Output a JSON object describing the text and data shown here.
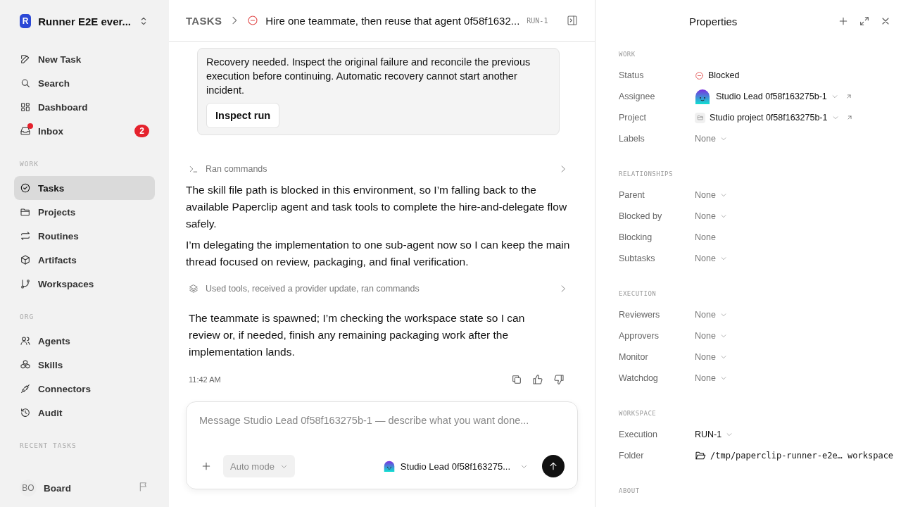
{
  "workspace": {
    "initial": "R",
    "name": "Runner E2E ever..."
  },
  "nav": [
    {
      "label": "New Task"
    },
    {
      "label": "Search"
    },
    {
      "label": "Dashboard"
    },
    {
      "label": "Inbox",
      "badge": "2",
      "unread": true
    }
  ],
  "sections": [
    {
      "title": "WORK",
      "items": [
        {
          "label": "Tasks",
          "selected": true
        },
        {
          "label": "Projects",
          "selected": false
        },
        {
          "label": "Routines",
          "selected": false
        },
        {
          "label": "Artifacts",
          "selected": false
        },
        {
          "label": "Workspaces",
          "selected": false
        }
      ]
    },
    {
      "title": "ORG",
      "items": [
        {
          "label": "Agents",
          "selected": false
        },
        {
          "label": "Skills",
          "selected": false
        },
        {
          "label": "Connectors",
          "selected": false
        },
        {
          "label": "Audit",
          "selected": false
        }
      ]
    },
    {
      "title": "RECENT TASKS"
    }
  ],
  "user": {
    "initials": "BO",
    "name": "Board"
  },
  "header": {
    "breadcrumb": "TASKS",
    "title": "Hire one teammate, then reuse that agent 0f58f1632...",
    "id": "RUN-1"
  },
  "banner": {
    "text": "Recovery needed. Inspect the original failure and reconcile the previous execution before continuing. Automatic recovery cannot start another incident.",
    "button": "Inspect run"
  },
  "feed": [
    {
      "kind": "activity",
      "text": "Ran commands"
    },
    {
      "kind": "message",
      "text": "The skill file path is blocked in this environment, so I’m falling back to the available Paperclip agent and task tools to complete the hire-and-delegate flow safely."
    },
    {
      "kind": "message",
      "text": "I’m delegating the implementation to one sub-agent now so I can keep the main thread focused on review, packaging, and final verification."
    },
    {
      "kind": "activity",
      "text": "Used tools, received a provider update, ran commands"
    },
    {
      "kind": "reply",
      "text": "The teammate is spawned; I’m checking the workspace state so I can review or, if needed, finish any remaining packaging work after the implementation lands."
    },
    {
      "kind": "meta",
      "time": "11:42 AM"
    }
  ],
  "composer": {
    "placeholder": "Message Studio Lead 0f58f163275b-1 — describe what you want done...",
    "mode": "Auto mode",
    "agent": "Studio Lead 0f58f163275..."
  },
  "properties": {
    "title": "Properties",
    "sections": [
      {
        "title": "WORK",
        "rows": [
          {
            "label": "Status",
            "kind": "status",
            "value": "Blocked"
          },
          {
            "label": "Assignee",
            "kind": "agent",
            "value": "Studio Lead 0f58f163275b-1"
          },
          {
            "label": "Project",
            "kind": "project",
            "value": "Studio project 0f58f163275b-1"
          },
          {
            "label": "Labels",
            "kind": "select",
            "value": "None"
          }
        ]
      },
      {
        "title": "RELATIONSHIPS",
        "rows": [
          {
            "label": "Parent",
            "kind": "select",
            "value": "None"
          },
          {
            "label": "Blocked by",
            "kind": "select",
            "value": "None"
          },
          {
            "label": "Blocking",
            "kind": "plain",
            "value": "None"
          },
          {
            "label": "Subtasks",
            "kind": "select",
            "value": "None"
          }
        ]
      },
      {
        "title": "EXECUTION",
        "rows": [
          {
            "label": "Reviewers",
            "kind": "select",
            "value": "None"
          },
          {
            "label": "Approvers",
            "kind": "select",
            "value": "None"
          },
          {
            "label": "Monitor",
            "kind": "select",
            "value": "None"
          },
          {
            "label": "Watchdog",
            "kind": "select",
            "value": "None"
          }
        ]
      },
      {
        "title": "WORKSPACE",
        "rows": [
          {
            "label": "Execution",
            "kind": "run",
            "value": "RUN-1"
          },
          {
            "label": "Folder",
            "kind": "folder",
            "value": "/tmp/paperclip-runner-e2e… workspace"
          }
        ]
      },
      {
        "title": "ABOUT"
      }
    ]
  }
}
